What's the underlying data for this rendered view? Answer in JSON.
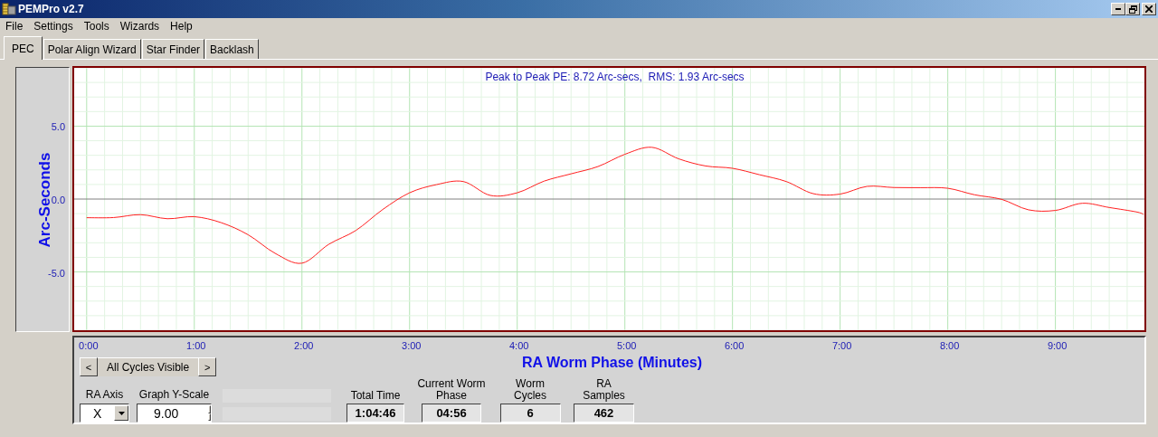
{
  "window": {
    "title": "PEMPro v2.7"
  },
  "menu": [
    "File",
    "Settings",
    "Tools",
    "Wizards",
    "Help"
  ],
  "tabs": [
    {
      "label": "PEC",
      "selected": true
    },
    {
      "label": "Polar Align Wizard",
      "selected": false
    },
    {
      "label": "Star Finder",
      "selected": false
    },
    {
      "label": "Backlash",
      "selected": false
    }
  ],
  "chart": {
    "chart_data": {
      "type": "line",
      "title": "Peak to Peak PE: 8.72 Arc-secs,  RMS: 1.93 Arc-secs",
      "xlabel": "RA Worm Phase (Minutes)",
      "ylabel": "Arc-Seconds",
      "x": [
        0,
        0.25,
        0.5,
        0.75,
        1,
        1.25,
        1.5,
        1.75,
        2,
        2.25,
        2.5,
        2.75,
        3,
        3.25,
        3.5,
        3.75,
        4,
        4.25,
        4.5,
        4.75,
        5,
        5.25,
        5.5,
        5.75,
        6,
        6.25,
        6.5,
        6.75,
        7,
        7.25,
        7.5,
        7.75,
        8,
        8.25,
        8.5,
        8.75,
        9,
        9.25,
        9.5,
        9.75,
        9.82
      ],
      "values": [
        -1.28,
        -1.27,
        -1.07,
        -1.35,
        -1.21,
        -1.62,
        -2.45,
        -3.72,
        -4.4,
        -3.1,
        -2.16,
        -0.72,
        0.43,
        0.99,
        1.2,
        0.25,
        0.43,
        1.23,
        1.73,
        2.23,
        3.07,
        3.55,
        2.76,
        2.27,
        2.11,
        1.67,
        1.2,
        0.37,
        0.34,
        0.87,
        0.79,
        0.78,
        0.74,
        0.29,
        -0.02,
        -0.74,
        -0.78,
        -0.29,
        -0.58,
        -0.88,
        -1.05
      ],
      "xlim": [
        -0.116,
        9.827
      ],
      "ylim": [
        -9,
        9
      ],
      "grid": true,
      "xticks": [
        {
          "value": 0,
          "label": "0:00"
        },
        {
          "value": 1,
          "label": "1:00"
        },
        {
          "value": 2,
          "label": "2:00"
        },
        {
          "value": 3,
          "label": "3:00"
        },
        {
          "value": 4,
          "label": "4:00"
        },
        {
          "value": 5,
          "label": "5:00"
        },
        {
          "value": 6,
          "label": "6:00"
        },
        {
          "value": 7,
          "label": "7:00"
        },
        {
          "value": 8,
          "label": "8:00"
        },
        {
          "value": 9,
          "label": "9:00"
        }
      ],
      "yticks": [
        {
          "value": 5,
          "label": "5.0"
        },
        {
          "value": 0,
          "label": "0.0"
        },
        {
          "value": -5,
          "label": "-5.0"
        }
      ]
    }
  },
  "controls": {
    "prev": "<",
    "cycles": "All Cycles Visible",
    "next": ">",
    "ra_axis": {
      "label": "RA Axis",
      "value": "X"
    },
    "y_scale": {
      "label": "Graph Y-Scale",
      "value": "9.00"
    },
    "stats": [
      {
        "label": "Total Time",
        "value": "1:04:46"
      },
      {
        "label": "Current Worm Phase",
        "value": "04:56"
      },
      {
        "label": "Worm Cycles",
        "value": "6"
      },
      {
        "label": "RA Samples",
        "value": "462"
      }
    ]
  }
}
